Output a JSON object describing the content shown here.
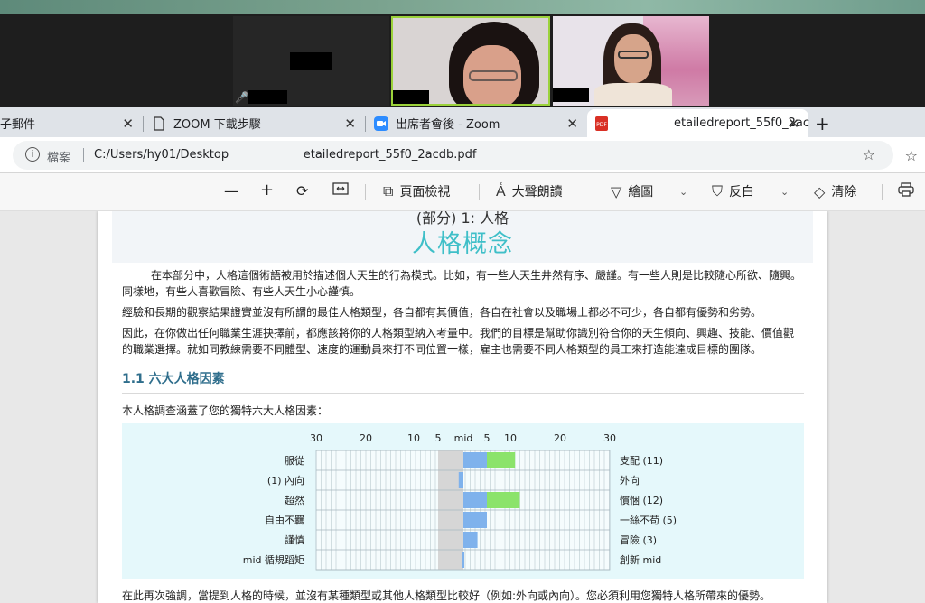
{
  "zoom": {
    "participants": [
      {
        "tile": "left",
        "muted": true
      },
      {
        "tile": "center",
        "active_speaker": true
      },
      {
        "tile": "right"
      }
    ]
  },
  "tabs": [
    {
      "label": "子郵件",
      "icon": "mail-icon"
    },
    {
      "label": "ZOOM 下載步驟",
      "icon": "document-icon"
    },
    {
      "label": "出席者會後 - Zoom",
      "icon": "zoom-icon"
    },
    {
      "label": "etailedreport_55f0_2ac",
      "icon": "pdf-icon",
      "active": true
    }
  ],
  "tab_new_label": "+",
  "address": {
    "scheme": "檔案",
    "url": "C:/Users/hy01/Desktop                    etailedreport_55f0_2acdb.pdf"
  },
  "toolbar": {
    "zoom_out": "—",
    "zoom_in": "+",
    "page_view": "頁面檢視",
    "read_aloud": "大聲朗讀",
    "draw": "繪圖",
    "highlight": "反白",
    "erase": "清除"
  },
  "document": {
    "part_label": "(部分) 1: 人格",
    "title": "人格概念",
    "paragraphs": [
      "在本部分中，人格這個術語被用於描述個人天生的行為模式。比如，有一些人天生井然有序、嚴謹。有一些人則是比較隨心所欲、隨興。同樣地，有些人喜歡冒險、有些人天生小心謹慎。",
      "經驗和長期的觀察結果證實並沒有所謂的最佳人格類型，各自都有其價值，各自在社會以及職場上都必不可少，各自都有優勢和劣勢。",
      "因此，在你做出任何職業生涯抉擇前，都應該將你的人格類型納入考量中。我們的目標是幫助你識別符合你的天生傾向、興趣、技能、價值觀的職業選擇。就如同教練需要不同體型、速度的運動員來打不同位置一樣，雇主也需要不同人格類型的員工來打造能達成目標的團隊。"
    ],
    "section_title": "1.1 六大人格因素",
    "section_intro": "本人格調查涵蓋了您的獨特六大人格因素：",
    "footer_text": "在此再次強調，當提到人格的時候，並沒有某種類型或其他人格類型比較好（例如:外向或內向）。您必須利用您獨特人格所帶來的優勢。"
  },
  "chart_data": {
    "type": "bar",
    "orientation": "horizontal-diverging",
    "axis_ticks": [
      "30",
      "20",
      "10",
      "5",
      "mid",
      "5",
      "10",
      "20",
      "30"
    ],
    "rows": [
      {
        "left_label": "服從",
        "right_label": "支配 (11)",
        "value": 11,
        "side": "right"
      },
      {
        "left_label": "(1) 內向",
        "right_label": "外向",
        "value": 1,
        "side": "left"
      },
      {
        "left_label": "超然",
        "right_label": "慣悃 (12)",
        "value": 12,
        "side": "right"
      },
      {
        "left_label": "自由不羈",
        "right_label": "一絲不苟 (5)",
        "value": 5,
        "side": "right"
      },
      {
        "left_label": "謹慎",
        "right_label": "冒險 (3)",
        "value": 3,
        "side": "right"
      },
      {
        "left_label": "mid 循規蹈矩",
        "right_label": "創新 mid",
        "value": 0,
        "side": "mid"
      }
    ],
    "colors": {
      "inner": "#7fb2ec",
      "outer": "#8be36b",
      "mid_band": "#d6d6d6",
      "grid": "#b9c9cf"
    }
  }
}
